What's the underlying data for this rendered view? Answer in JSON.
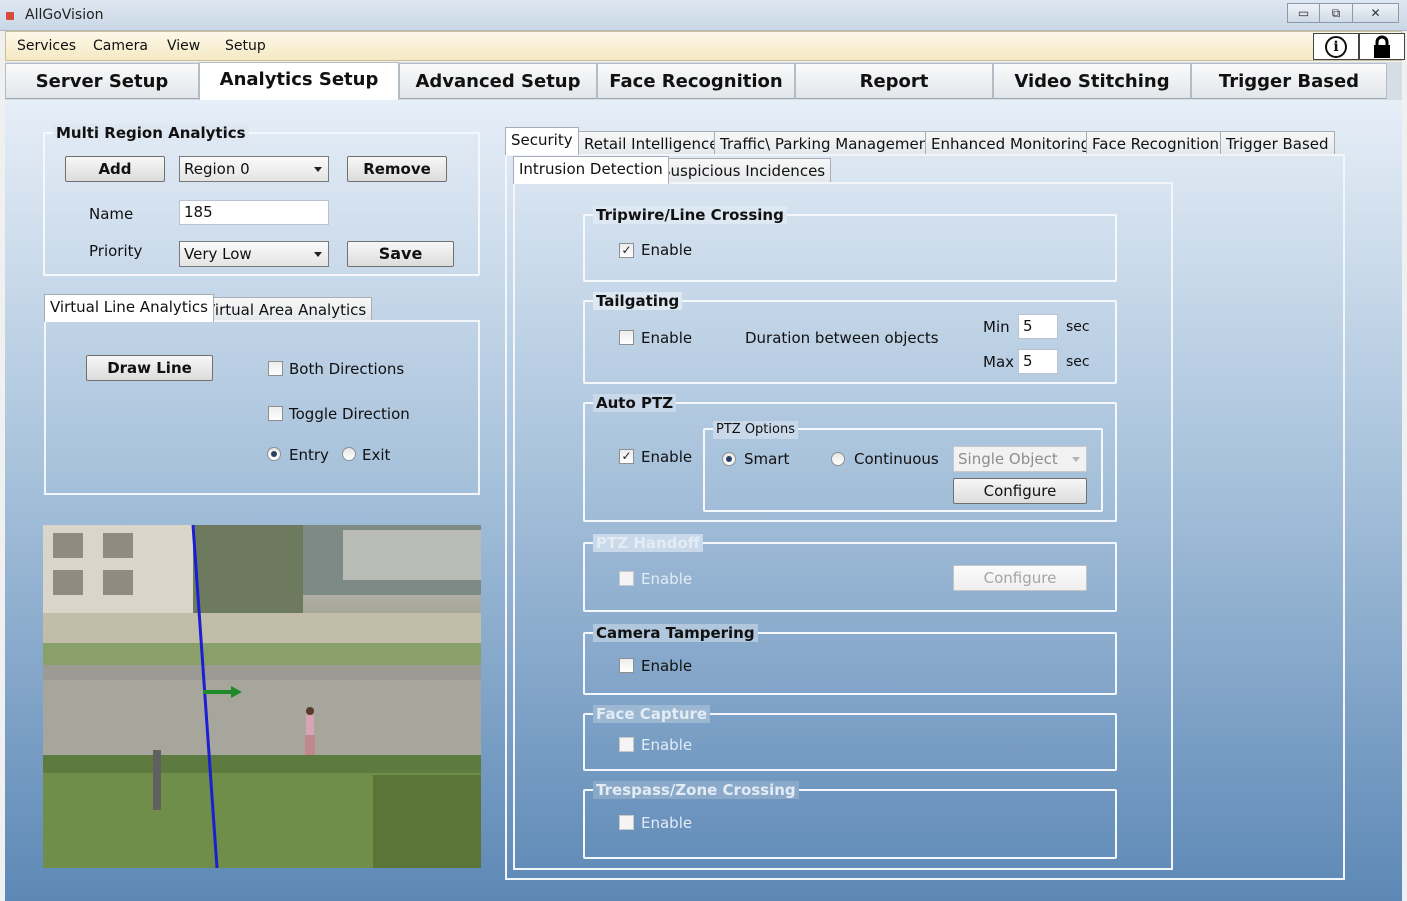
{
  "window": {
    "title": "AllGoVision",
    "minimize": "▭",
    "restore": "⧉",
    "close": "✕"
  },
  "menu": {
    "items": [
      "Services",
      "Camera",
      "View",
      "Setup"
    ],
    "info_icon": "info-icon",
    "lock_icon": "lock-icon"
  },
  "main_tabs": [
    "Server Setup",
    "Analytics Setup",
    "Advanced Setup",
    "Face Recognition",
    "Report",
    "Video Stitching",
    "Trigger Based"
  ],
  "multi_region": {
    "title": "Multi Region Analytics",
    "add_label": "Add",
    "region_value": "Region 0",
    "remove_label": "Remove",
    "name_label": "Name",
    "name_value": "185",
    "priority_label": "Priority",
    "priority_value": "Very Low",
    "save_label": "Save"
  },
  "line_tabs": [
    "Virtual Line Analytics",
    "Virtual Area Analytics"
  ],
  "virtual_line": {
    "draw_line_label": "Draw Line",
    "both_directions": "Both Directions",
    "toggle_direction": "Toggle Direction",
    "entry": "Entry",
    "exit": "Exit"
  },
  "analytics_tabs": [
    "Security",
    "Retail Intelligence",
    "Traffic\\ Parking Management",
    "Enhanced Monitoring",
    "Face Recognition",
    "Trigger Based"
  ],
  "security_tabs": [
    "Intrusion Detection",
    "Suspicious Incidences"
  ],
  "sections": {
    "tripwire": {
      "title": "Tripwire/Line Crossing",
      "enable": "Enable"
    },
    "tailgating": {
      "title": "Tailgating",
      "enable": "Enable",
      "duration_label": "Duration between objects",
      "min_label": "Min",
      "min_value": "5",
      "max_label": "Max",
      "max_value": "5",
      "unit": "sec"
    },
    "auto_ptz": {
      "title": "Auto PTZ",
      "enable": "Enable",
      "options_title": "PTZ Options",
      "smart": "Smart",
      "continuous": "Continuous",
      "object_value": "Single Object",
      "configure": "Configure"
    },
    "ptz_handoff": {
      "title": "PTZ Handoff",
      "enable": "Enable",
      "configure": "Configure"
    },
    "camera_tampering": {
      "title": "Camera Tampering",
      "enable": "Enable"
    },
    "face_capture": {
      "title": "Face Capture",
      "enable": "Enable"
    },
    "trespass": {
      "title": "Trespass/Zone Crossing",
      "enable": "Enable"
    }
  },
  "checkbox_states": {
    "tripwire": true,
    "tailgating": false,
    "auto_ptz": true,
    "ptz_handoff": false,
    "camera_tampering": false,
    "face_capture": false,
    "trespass": false,
    "both_directions": false,
    "toggle_direction": false
  },
  "radio_states": {
    "entry": true,
    "exit": false,
    "smart": true,
    "continuous": false
  },
  "colors": {
    "virtual_line": "#1a1fd6",
    "direction_arrow": "#1e8a2a"
  }
}
